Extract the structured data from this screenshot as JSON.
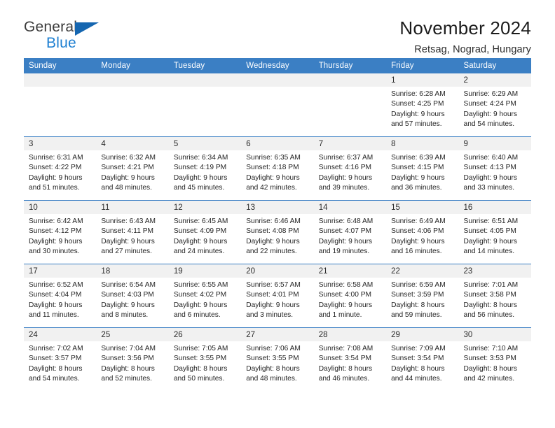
{
  "brand": {
    "name_part1": "General",
    "name_part2": "Blue",
    "triangle_color": "#1566b0",
    "blue_color": "#1d7fd1",
    "gray_color": "#3b3b3b"
  },
  "header": {
    "title": "November 2024",
    "subtitle": "Retsag, Nograd, Hungary"
  },
  "theme": {
    "header_bg": "#3b7fc4",
    "header_text": "#ffffff",
    "daynum_band_bg": "#f1f1f1",
    "row_divider": "#3b7fc4",
    "body_bg": "#ffffff"
  },
  "weekdays": [
    "Sunday",
    "Monday",
    "Tuesday",
    "Wednesday",
    "Thursday",
    "Friday",
    "Saturday"
  ],
  "weeks": [
    [
      {
        "day": "",
        "empty": true
      },
      {
        "day": "",
        "empty": true
      },
      {
        "day": "",
        "empty": true
      },
      {
        "day": "",
        "empty": true
      },
      {
        "day": "",
        "empty": true
      },
      {
        "day": "1",
        "sunrise": "Sunrise: 6:28 AM",
        "sunset": "Sunset: 4:25 PM",
        "daylight_line1": "Daylight: 9 hours",
        "daylight_line2": "and 57 minutes."
      },
      {
        "day": "2",
        "sunrise": "Sunrise: 6:29 AM",
        "sunset": "Sunset: 4:24 PM",
        "daylight_line1": "Daylight: 9 hours",
        "daylight_line2": "and 54 minutes."
      }
    ],
    [
      {
        "day": "3",
        "sunrise": "Sunrise: 6:31 AM",
        "sunset": "Sunset: 4:22 PM",
        "daylight_line1": "Daylight: 9 hours",
        "daylight_line2": "and 51 minutes."
      },
      {
        "day": "4",
        "sunrise": "Sunrise: 6:32 AM",
        "sunset": "Sunset: 4:21 PM",
        "daylight_line1": "Daylight: 9 hours",
        "daylight_line2": "and 48 minutes."
      },
      {
        "day": "5",
        "sunrise": "Sunrise: 6:34 AM",
        "sunset": "Sunset: 4:19 PM",
        "daylight_line1": "Daylight: 9 hours",
        "daylight_line2": "and 45 minutes."
      },
      {
        "day": "6",
        "sunrise": "Sunrise: 6:35 AM",
        "sunset": "Sunset: 4:18 PM",
        "daylight_line1": "Daylight: 9 hours",
        "daylight_line2": "and 42 minutes."
      },
      {
        "day": "7",
        "sunrise": "Sunrise: 6:37 AM",
        "sunset": "Sunset: 4:16 PM",
        "daylight_line1": "Daylight: 9 hours",
        "daylight_line2": "and 39 minutes."
      },
      {
        "day": "8",
        "sunrise": "Sunrise: 6:39 AM",
        "sunset": "Sunset: 4:15 PM",
        "daylight_line1": "Daylight: 9 hours",
        "daylight_line2": "and 36 minutes."
      },
      {
        "day": "9",
        "sunrise": "Sunrise: 6:40 AM",
        "sunset": "Sunset: 4:13 PM",
        "daylight_line1": "Daylight: 9 hours",
        "daylight_line2": "and 33 minutes."
      }
    ],
    [
      {
        "day": "10",
        "sunrise": "Sunrise: 6:42 AM",
        "sunset": "Sunset: 4:12 PM",
        "daylight_line1": "Daylight: 9 hours",
        "daylight_line2": "and 30 minutes."
      },
      {
        "day": "11",
        "sunrise": "Sunrise: 6:43 AM",
        "sunset": "Sunset: 4:11 PM",
        "daylight_line1": "Daylight: 9 hours",
        "daylight_line2": "and 27 minutes."
      },
      {
        "day": "12",
        "sunrise": "Sunrise: 6:45 AM",
        "sunset": "Sunset: 4:09 PM",
        "daylight_line1": "Daylight: 9 hours",
        "daylight_line2": "and 24 minutes."
      },
      {
        "day": "13",
        "sunrise": "Sunrise: 6:46 AM",
        "sunset": "Sunset: 4:08 PM",
        "daylight_line1": "Daylight: 9 hours",
        "daylight_line2": "and 22 minutes."
      },
      {
        "day": "14",
        "sunrise": "Sunrise: 6:48 AM",
        "sunset": "Sunset: 4:07 PM",
        "daylight_line1": "Daylight: 9 hours",
        "daylight_line2": "and 19 minutes."
      },
      {
        "day": "15",
        "sunrise": "Sunrise: 6:49 AM",
        "sunset": "Sunset: 4:06 PM",
        "daylight_line1": "Daylight: 9 hours",
        "daylight_line2": "and 16 minutes."
      },
      {
        "day": "16",
        "sunrise": "Sunrise: 6:51 AM",
        "sunset": "Sunset: 4:05 PM",
        "daylight_line1": "Daylight: 9 hours",
        "daylight_line2": "and 14 minutes."
      }
    ],
    [
      {
        "day": "17",
        "sunrise": "Sunrise: 6:52 AM",
        "sunset": "Sunset: 4:04 PM",
        "daylight_line1": "Daylight: 9 hours",
        "daylight_line2": "and 11 minutes."
      },
      {
        "day": "18",
        "sunrise": "Sunrise: 6:54 AM",
        "sunset": "Sunset: 4:03 PM",
        "daylight_line1": "Daylight: 9 hours",
        "daylight_line2": "and 8 minutes."
      },
      {
        "day": "19",
        "sunrise": "Sunrise: 6:55 AM",
        "sunset": "Sunset: 4:02 PM",
        "daylight_line1": "Daylight: 9 hours",
        "daylight_line2": "and 6 minutes."
      },
      {
        "day": "20",
        "sunrise": "Sunrise: 6:57 AM",
        "sunset": "Sunset: 4:01 PM",
        "daylight_line1": "Daylight: 9 hours",
        "daylight_line2": "and 3 minutes."
      },
      {
        "day": "21",
        "sunrise": "Sunrise: 6:58 AM",
        "sunset": "Sunset: 4:00 PM",
        "daylight_line1": "Daylight: 9 hours",
        "daylight_line2": "and 1 minute."
      },
      {
        "day": "22",
        "sunrise": "Sunrise: 6:59 AM",
        "sunset": "Sunset: 3:59 PM",
        "daylight_line1": "Daylight: 8 hours",
        "daylight_line2": "and 59 minutes."
      },
      {
        "day": "23",
        "sunrise": "Sunrise: 7:01 AM",
        "sunset": "Sunset: 3:58 PM",
        "daylight_line1": "Daylight: 8 hours",
        "daylight_line2": "and 56 minutes."
      }
    ],
    [
      {
        "day": "24",
        "sunrise": "Sunrise: 7:02 AM",
        "sunset": "Sunset: 3:57 PM",
        "daylight_line1": "Daylight: 8 hours",
        "daylight_line2": "and 54 minutes."
      },
      {
        "day": "25",
        "sunrise": "Sunrise: 7:04 AM",
        "sunset": "Sunset: 3:56 PM",
        "daylight_line1": "Daylight: 8 hours",
        "daylight_line2": "and 52 minutes."
      },
      {
        "day": "26",
        "sunrise": "Sunrise: 7:05 AM",
        "sunset": "Sunset: 3:55 PM",
        "daylight_line1": "Daylight: 8 hours",
        "daylight_line2": "and 50 minutes."
      },
      {
        "day": "27",
        "sunrise": "Sunrise: 7:06 AM",
        "sunset": "Sunset: 3:55 PM",
        "daylight_line1": "Daylight: 8 hours",
        "daylight_line2": "and 48 minutes."
      },
      {
        "day": "28",
        "sunrise": "Sunrise: 7:08 AM",
        "sunset": "Sunset: 3:54 PM",
        "daylight_line1": "Daylight: 8 hours",
        "daylight_line2": "and 46 minutes."
      },
      {
        "day": "29",
        "sunrise": "Sunrise: 7:09 AM",
        "sunset": "Sunset: 3:54 PM",
        "daylight_line1": "Daylight: 8 hours",
        "daylight_line2": "and 44 minutes."
      },
      {
        "day": "30",
        "sunrise": "Sunrise: 7:10 AM",
        "sunset": "Sunset: 3:53 PM",
        "daylight_line1": "Daylight: 8 hours",
        "daylight_line2": "and 42 minutes."
      }
    ]
  ]
}
